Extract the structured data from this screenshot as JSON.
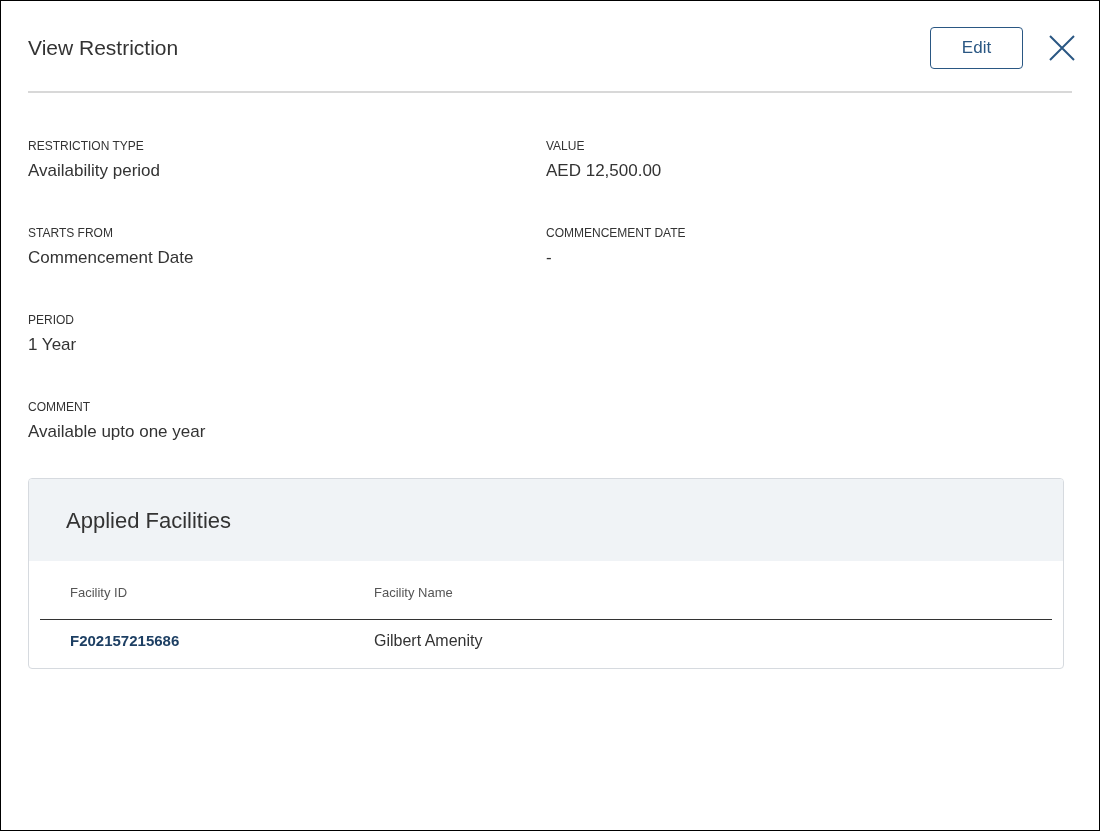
{
  "title": "View Restriction",
  "edit_button": "Edit",
  "field_rows": [
    [
      {
        "label": "RESTRICTION TYPE",
        "value": "Availability period"
      },
      {
        "label": "VALUE",
        "value": "AED 12,500.00"
      }
    ],
    [
      {
        "label": "STARTS FROM",
        "value": "Commencement Date"
      },
      {
        "label": "COMMENCEMENT DATE",
        "value": "-"
      }
    ],
    [
      {
        "label": "PERIOD",
        "value": "1 Year"
      }
    ],
    [
      {
        "label": "COMMENT",
        "value": "Available upto one year"
      }
    ]
  ],
  "facilities": {
    "title": "Applied Facilities",
    "columns": [
      "Facility ID",
      "Facility Name"
    ],
    "rows": [
      [
        "F202157215686",
        "Gilbert Amenity"
      ]
    ]
  }
}
